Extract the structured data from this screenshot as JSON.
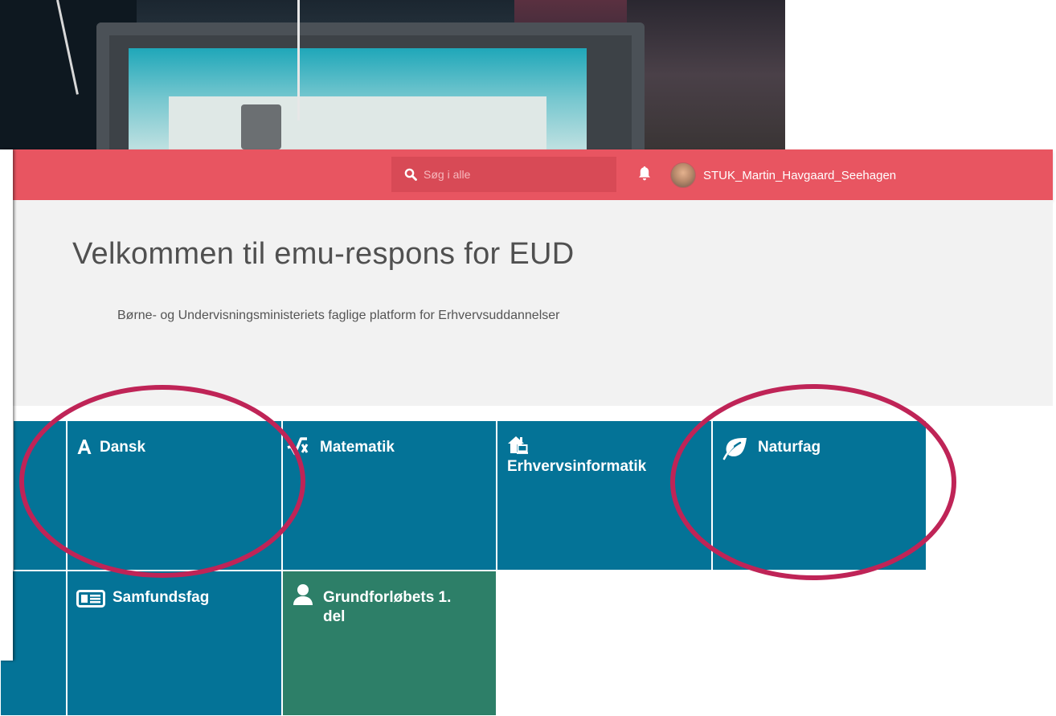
{
  "header": {
    "search_placeholder": "Søg i alle",
    "username": "STUK_Martin_Havgaard_Seehagen"
  },
  "welcome": {
    "title": "Velkommen til emu-respons for EUD",
    "subtitle": "Børne- og Undervisningsministeriets faglige platform for Erhvervsuddannelser"
  },
  "tiles": {
    "dansk": "Dansk",
    "matematik": "Matematik",
    "erhvervsinformatik": "Erhvervsinformatik",
    "naturfag": "Naturfag",
    "samfundsfag": "Samfundsfag",
    "grundforloeb": "Grundforløbets 1. del"
  },
  "colors": {
    "header_bg": "#e85561",
    "tile_blue": "#047397",
    "tile_green": "#2d7f68",
    "highlight_oval": "#bf2457"
  },
  "icons": {
    "search": "search-icon",
    "notifications": "bell-icon",
    "dansk": "letter-a-icon",
    "matematik": "square-root-icon",
    "erhvervsinformatik": "home-computer-icon",
    "naturfag": "leaf-icon",
    "samfundsfag": "newspaper-icon",
    "grundforloeb": "user-icon"
  }
}
